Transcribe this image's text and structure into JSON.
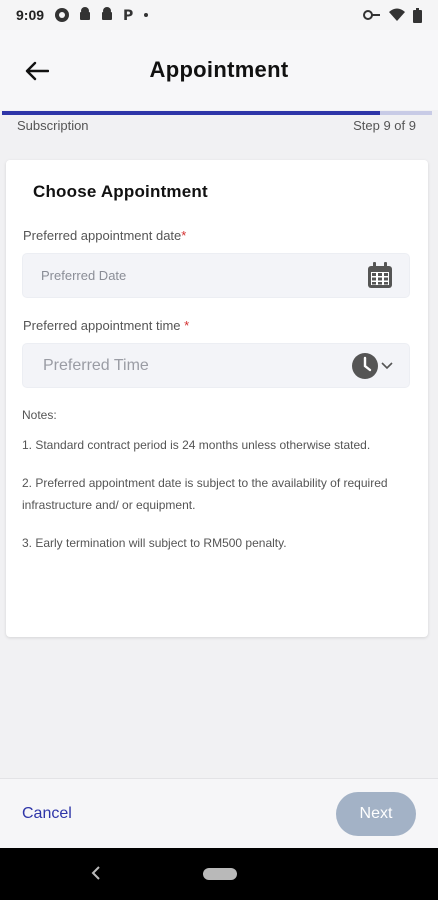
{
  "status_bar": {
    "time": "9:09"
  },
  "app_bar": {
    "title": "Appointment"
  },
  "progress": {
    "section": "Subscription",
    "step": "Step 9 of 9",
    "fraction": 0.88
  },
  "card": {
    "title": "Choose Appointment",
    "date_field": {
      "label": "Preferred appointment date",
      "required": "*",
      "placeholder": "Preferred Date"
    },
    "time_field": {
      "label": "Preferred appointment time ",
      "required": "*",
      "placeholder": "Preferred Time"
    },
    "notes": {
      "heading": "Notes:",
      "items": [
        "1. Standard contract period is 24 months unless otherwise stated.",
        "2. Preferred appointment date is subject to the availability of required infrastructure and/ or equipment.",
        "3. Early termination will subject to RM500 penalty."
      ]
    }
  },
  "footer": {
    "cancel_label": "Cancel",
    "next_label": "Next"
  },
  "colors": {
    "accent": "#2e35a8",
    "next_disabled": "#a3b2c6",
    "required": "#d32f2f"
  }
}
